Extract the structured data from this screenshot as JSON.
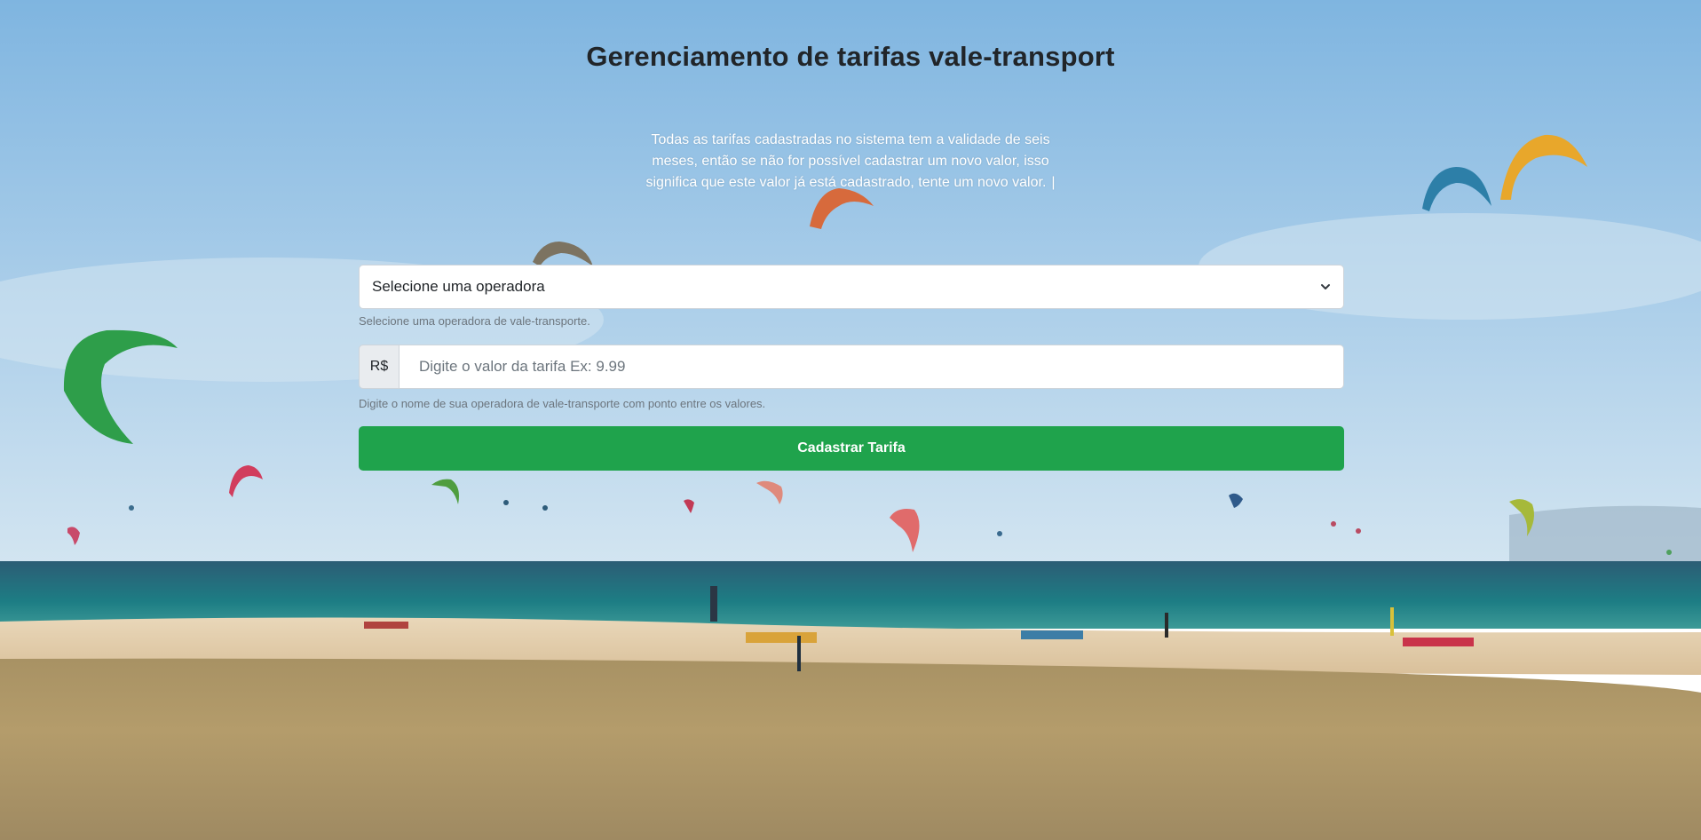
{
  "header": {
    "title": "Gerenciamento de tarifas vale-transport"
  },
  "intro": {
    "text": "Todas as tarifas cadastradas no sistema tem a validade de seis meses, então se não for possível cadastrar um novo valor, isso significa que este valor já está cadastrado, tente um novo valor.",
    "cursor": "|"
  },
  "form": {
    "operator_select": {
      "selected": "Selecione uma operadora",
      "icon": "chevron-down-icon",
      "help": "Selecione uma operadora de vale-transporte."
    },
    "fare_input": {
      "prefix": "R$",
      "value": "",
      "placeholder": "Digite o valor da tarifa Ex: 9.99",
      "help": "Digite o nome de sua operadora de vale-transporte com ponto entre os valores."
    },
    "submit_label": "Cadastrar Tarifa"
  },
  "colors": {
    "button_green": "#1fa34c",
    "title_text": "#212529",
    "help_text": "#6c757d"
  }
}
